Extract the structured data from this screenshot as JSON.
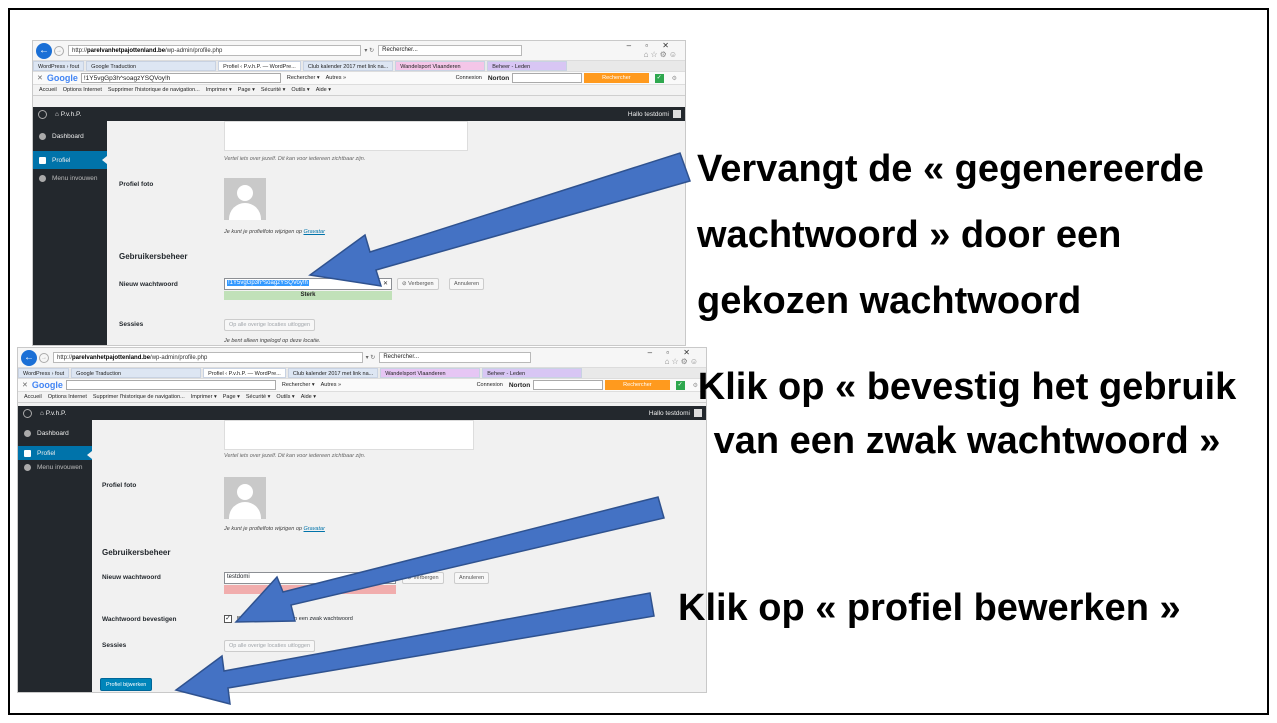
{
  "screenshot1": {
    "browser": {
      "url_prefix": "http://",
      "url_domain": "parelvanhetpajottenland.be",
      "url_path": "/wp-admin/profile.php",
      "refresh": "▾ ↻",
      "search_placeholder": "Rechercher...",
      "tabs": [
        "WordPress › fout",
        "Google Traduction",
        "Profiel ‹ P.v.h.P. — WordPre...",
        "Club kalender 2017 met link na...",
        "Wandelsport Vlaanderen",
        "Beheer - Leden"
      ],
      "google_label": "Google",
      "google_query": "!1Y5vgGp3h^soagzYSQVoy!h",
      "search_items": [
        "Rechercher ▾",
        "Autres »"
      ],
      "connexion": "Connexion",
      "norton": "Norton",
      "rechercher_btn": "Rechercher",
      "cmd_items": [
        "Accueil",
        "Options Internet",
        "Supprimer l'historique de navigation...",
        "Imprimer ▾",
        "Page ▾",
        "Sécurité ▾",
        "Outils ▾",
        "Aide ▾"
      ]
    },
    "wp": {
      "site": "P.v.h.P.",
      "greeting": "Hallo testdomi",
      "menu": [
        "Dashboard",
        "Profiel",
        "Menu invouwen"
      ],
      "bio_desc": "Vertel iets over jezelf. Dit kan voor iedereen zichtbaar zijn.",
      "profile_photo_label": "Profiel foto",
      "gravatar_text": "Je kunt je profielfoto wijzigen op ",
      "gravatar_link": "Gravatar",
      "section_title": "Gebruikersbeheer",
      "new_password_label": "Nieuw wachtwoord",
      "password_value": "!1Y5vgGp3h^soagzYSQVoy!h",
      "hide_button": "Verbergen",
      "cancel_button": "Annuleren",
      "strength": "Sterk",
      "sessions_label": "Sessies",
      "logout_button": "Op alle overige locaties uitloggen",
      "sessions_note": "Je bent alleen ingelogd op deze locatie."
    }
  },
  "screenshot2": {
    "browser": {
      "url_prefix": "http://",
      "url_domain": "parelvanhetpajottenland.be",
      "url_path": "/wp-admin/profile.php",
      "refresh": "▾ ↻",
      "search_placeholder": "Rechercher...",
      "tabs": [
        "WordPress › fout",
        "Google Traduction",
        "Profiel ‹ P.v.h.P. — WordPre...",
        "Club kalender 2017 met link na...",
        "Wandelsport Vlaanderen",
        "Beheer - Leden"
      ],
      "google_label": "Google",
      "google_query": "",
      "search_items": [
        "Rechercher ▾",
        "Autres »"
      ],
      "connexion": "Connexion",
      "norton": "Norton",
      "rechercher_btn": "Rechercher",
      "cmd_items": [
        "Accueil",
        "Options Internet",
        "Supprimer l'historique de navigation...",
        "Imprimer ▾",
        "Page ▾",
        "Sécurité ▾",
        "Outils ▾",
        "Aide ▾"
      ]
    },
    "wp": {
      "site": "P.v.h.P.",
      "greeting": "Hallo testdomi",
      "menu": [
        "Dashboard",
        "Profiel",
        "Menu invouwen"
      ],
      "bio_desc": "Vertel iets over jezelf. Dit kan voor iedereen zichtbaar zijn.",
      "profile_photo_label": "Profiel foto",
      "gravatar_text": "Je kunt je profielfoto wijzigen op ",
      "gravatar_link": "Gravatar",
      "section_title": "Gebruikersbeheer",
      "new_password_label": "Nieuw wachtwoord",
      "password_value": "testdomi",
      "hide_button": "Verbergen",
      "cancel_button": "Annuleren",
      "confirm_label": "Wachtwoord bevestigen",
      "confirm_text": "Bevestig het gebruik van een zwak wachtwoord",
      "sessions_label": "Sessies",
      "logout_button": "Op alle overige locaties uitloggen",
      "submit_button": "Profiel bijwerken"
    }
  },
  "callouts": {
    "c1": [
      "Vervangt de « gegenereerde",
      "wachtwoord » door een",
      "gekozen wachtwoord"
    ],
    "c2": [
      "Klik op  « bevestig het gebruik",
      "van een zwak wachtwoord »"
    ],
    "c3": "Klik op  « profiel bewerken »"
  },
  "colors": {
    "arrow_fill": "#4472c4",
    "arrow_stroke": "#2f528f",
    "wp_dark": "#23282d",
    "wp_blue": "#0073aa"
  }
}
